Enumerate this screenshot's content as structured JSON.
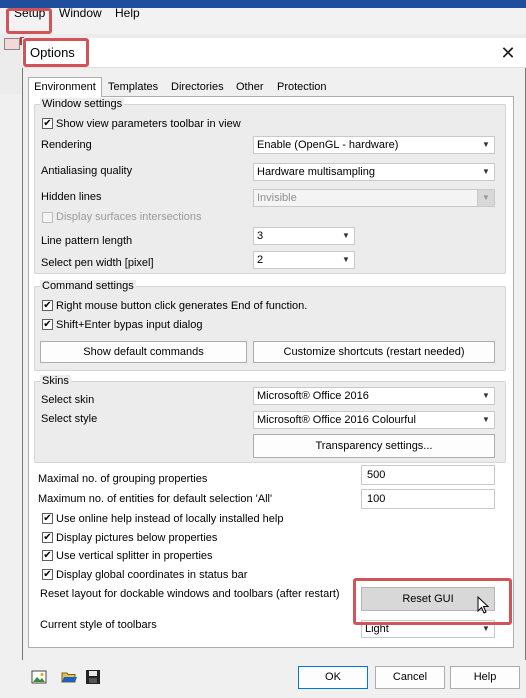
{
  "menubar": {
    "items": [
      "Setup",
      "Window",
      "Help"
    ]
  },
  "dialog": {
    "title": "Options",
    "close_glyph": "✕",
    "tabs": [
      "Environment",
      "Templates",
      "Directories",
      "Other",
      "Protection"
    ],
    "window_settings": {
      "title": "Window settings",
      "show_view_toolbar": "Show view parameters toolbar in view",
      "rendering_label": "Rendering",
      "rendering_value": "Enable (OpenGL - hardware)",
      "antialiasing_label": "Antialiasing quality",
      "antialiasing_value": "Hardware multisampling",
      "hidden_lines_label": "Hidden lines",
      "hidden_lines_value": "Invisible",
      "display_surfaces": "Display surfaces intersections",
      "line_pattern_label": "Line pattern length",
      "line_pattern_value": "3",
      "pen_width_label": "Select pen width [pixel]",
      "pen_width_value": "2"
    },
    "command_settings": {
      "title": "Command settings",
      "right_click": "Right mouse button click generates End of function.",
      "shift_enter": "Shift+Enter bypas input dialog",
      "show_default": "Show default commands",
      "customize": "Customize shortcuts (restart needed)"
    },
    "skins": {
      "title": "Skins",
      "skin_label": "Select skin",
      "skin_value": "Microsoft® Office 2016",
      "style_label": "Select style",
      "style_value": "Microsoft® Office 2016 Colourful",
      "transparency": "Transparency settings..."
    },
    "misc": {
      "grouping_label": "Maximal no. of grouping properties",
      "grouping_value": "500",
      "entities_label": "Maximum no. of entities for default selection 'All'",
      "entities_value": "100",
      "online_help": "Use online help instead of locally installed help",
      "pictures": "Display pictures below properties",
      "splitter": "Use vertical splitter in properties",
      "coords": "Display global coordinates in status bar",
      "reset_label": "Reset layout for dockable windows and toolbars (after restart)",
      "reset_button": "Reset GUI",
      "toolbar_style_label": "Current style of toolbars",
      "toolbar_style_value": "Light"
    },
    "buttons": {
      "ok": "OK",
      "cancel": "Cancel",
      "help": "Help"
    }
  },
  "icons": [
    "picture-icon",
    "open-folder-icon",
    "save-icon",
    "close-icon",
    "chevron-down-icon",
    "mouse-cursor-icon"
  ],
  "colors": {
    "highlight": "#d1545a",
    "app_bar": "#1f4e9c",
    "primary_border": "#0078d7"
  }
}
